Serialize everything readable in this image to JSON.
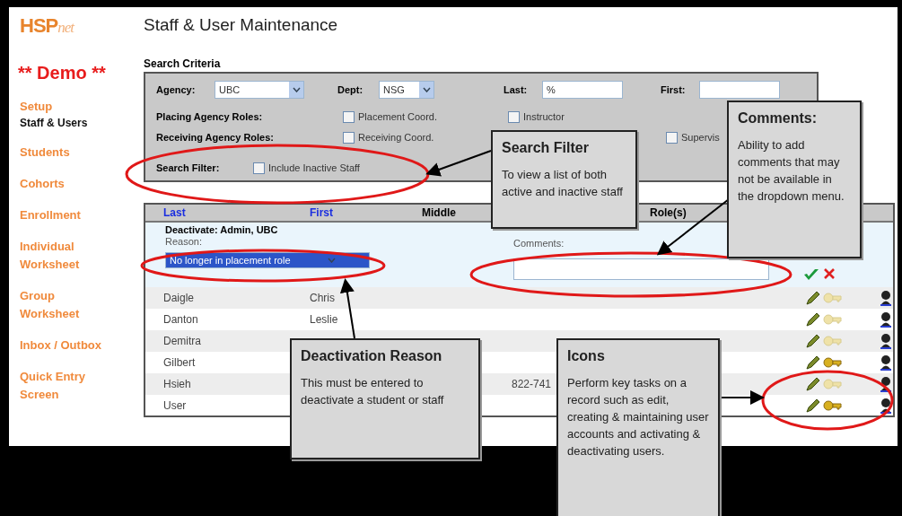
{
  "app": {
    "logo_main": "HSP",
    "logo_sub": "net",
    "title": "Staff & User Maintenance",
    "banner": "** Demo **"
  },
  "sidebar": {
    "items": [
      {
        "label": "Setup",
        "selected": false,
        "children": [
          {
            "label": "Staff & Users",
            "selected": true
          }
        ]
      },
      {
        "label": "Students",
        "selected": false
      },
      {
        "label": "Cohorts",
        "selected": false
      },
      {
        "label": "Enrollment",
        "selected": false
      },
      {
        "label": "Individual Worksheet",
        "selected": false
      },
      {
        "label": "Group Worksheet",
        "selected": false
      },
      {
        "label": "Inbox / Outbox",
        "selected": false
      },
      {
        "label": "Quick Entry Screen",
        "selected": false
      }
    ]
  },
  "search": {
    "heading": "Search Criteria",
    "agency": {
      "label": "Agency:",
      "value": "UBC"
    },
    "dept": {
      "label": "Dept:",
      "value": "NSG"
    },
    "last": {
      "label": "Last:",
      "value": "%"
    },
    "first": {
      "label": "First:"
    },
    "role_rows": [
      {
        "label": "Placing Agency Roles:",
        "options": [
          {
            "label": "Placement Coord.",
            "checked": false
          },
          {
            "label": "Instructor",
            "checked": false
          }
        ]
      },
      {
        "label": "Receiving Agency Roles:",
        "options": [
          {
            "label": "Receiving Coord.",
            "checked": false
          },
          {
            "label": "Supervis",
            "checked": false
          }
        ]
      }
    ],
    "filter": {
      "label": "Search Filter:",
      "option": {
        "label": "Include Inactive Staff",
        "checked": false
      }
    }
  },
  "table": {
    "columns": [
      {
        "label": "Last",
        "sortable": true
      },
      {
        "label": "First",
        "sortable": true
      },
      {
        "label": "Middle",
        "sortable": false
      },
      {
        "label": "Role(s)",
        "sortable": false
      }
    ],
    "deactivate": {
      "title": "Deactivate: Admin, UBC",
      "reason_label": "Reason:",
      "reason_value": "No longer in placement role",
      "comments_label": "Comments:"
    },
    "rows": [
      {
        "last": "Daigle",
        "first": "Chris",
        "key_active": false
      },
      {
        "last": "Danton",
        "first": "Leslie",
        "key_active": false
      },
      {
        "last": "Demitra",
        "key_active": false
      },
      {
        "last": "Gilbert",
        "key_active": true
      },
      {
        "last": "Hsieh",
        "column_4": "822-741",
        "key_active": false
      },
      {
        "last": "User",
        "key_active": true
      }
    ]
  },
  "callouts": [
    {
      "title": "Search Filter",
      "body": "To view a list of both active and inactive staff"
    },
    {
      "title": "Comments:",
      "body": "Ability to add comments that may not be available in the dropdown menu."
    },
    {
      "title": "Deactivation Reason",
      "body": "This must be entered to deactivate a student or staff"
    },
    {
      "title": "Icons",
      "body": "Perform key tasks on a record such as edit, creating & maintaining user accounts and activating & deactivating users."
    }
  ]
}
